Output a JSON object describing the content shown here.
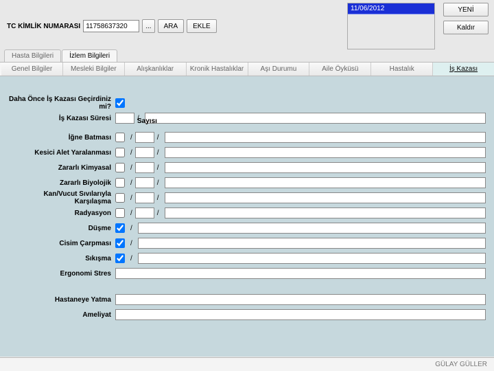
{
  "header": {
    "tc_label": "TC KİMLİK NUMARASI",
    "tc_value": "11758637320",
    "dots": "...",
    "ara": "ARA",
    "ekle": "EKLE",
    "list_selected": "11/06/2012",
    "yeni": "YENİ",
    "kaldir": "Kaldır"
  },
  "ptabs": {
    "hasta": "Hasta Bilgileri",
    "izlem": "İzlem Bilgileri"
  },
  "stabs": {
    "genel": "Genel Bilgiler",
    "mesleki": "Mesleki Bilgiler",
    "aliskanlik": "Alışkanlıklar",
    "kronik": "Kronik Hastalıklar",
    "asi": "Aşı Durumu",
    "aile": "Aile Öyküsü",
    "hastalik": "Hastalık",
    "iskazasi": "İş Kazası"
  },
  "form": {
    "daha_once": "Daha Önce İş Kazası Geçirdiniz mi?",
    "suresi": "İş Kazası Süresi",
    "sayisi": "Sayısı",
    "igne": "İğne Batması",
    "kesici": "Kesici Alet Yaralanması",
    "kimyasal": "Zararlı Kimyasal",
    "biyolojik": "Zararlı Biyolojik",
    "kan": "Kan/Vucut Sıvılarıyla Karşılaşma",
    "radyasyon": "Radyasyon",
    "dusme": "Düşme",
    "cisim": "Cisim Çarpması",
    "sikisma": "Sıkışma",
    "ergonomi": "Ergonomi Stres",
    "hastane": "Hastaneye Yatma",
    "ameliyat": "Ameliyat"
  },
  "status": "GÜLAY GÜLLER"
}
